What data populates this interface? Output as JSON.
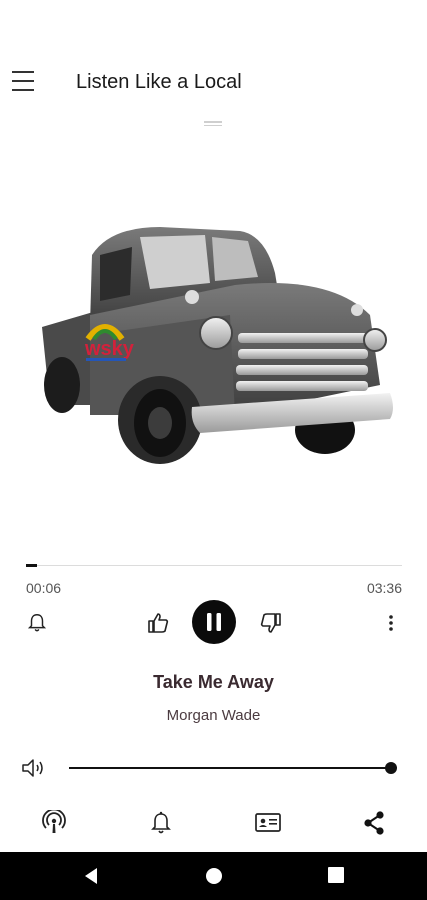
{
  "header": {
    "title": "Listen Like a Local",
    "menu_icon": "hamburger-menu-icon"
  },
  "artwork": {
    "description_icon": "album-art",
    "logo_text": "wsky",
    "alt": "Album artwork"
  },
  "player": {
    "elapsed": "00:06",
    "total": "03:36",
    "progress_fraction": 0.03,
    "track_title": "Take Me Away",
    "artist": "Morgan Wade",
    "volume_fraction": 1.0
  },
  "controls": [
    "alarm-icon",
    "thumbs-up-icon",
    "pause-icon",
    "thumbs-down-icon",
    "more-vert-icon"
  ],
  "bottom_bar": [
    "podcast-icon",
    "notification-bell-icon",
    "cast-contact-icon",
    "share-icon"
  ],
  "colors": {
    "accent": "#0b0b0b",
    "title": "#3a2a30",
    "nav_bar": "#000000"
  }
}
